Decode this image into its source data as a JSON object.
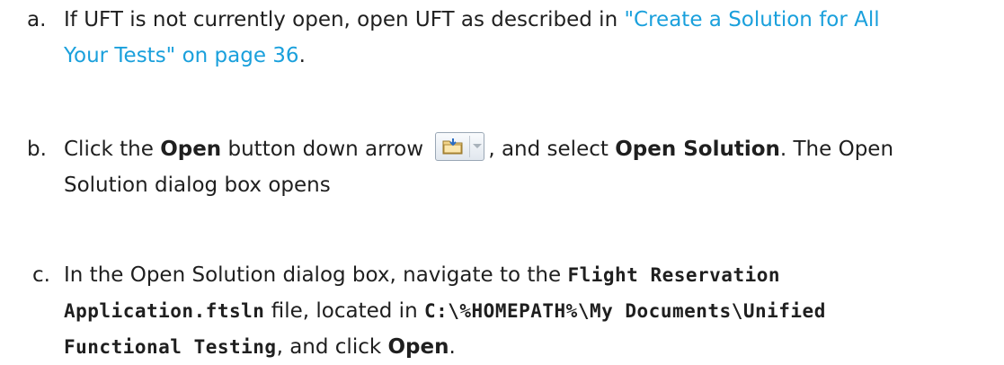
{
  "steps": [
    {
      "marker": "a.",
      "line1_text": "If UFT is not currently open, open UFT as described in ",
      "link_part1": "\"Create a Solution for All",
      "link_part2": "Your Tests\" on page 36",
      "line2_after": "."
    },
    {
      "marker": "b.",
      "t1": "Click the ",
      "b1": "Open",
      "t2": " button down arrow ",
      "t3": ", and select ",
      "b2": "Open Solution",
      "t4": ". The Open",
      "line2": "Solution dialog box opens"
    },
    {
      "marker": "c.",
      "t1": "In the Open Solution dialog box, navigate to the ",
      "b1": "Flight Reservation",
      "b2": "Application.ftsln",
      "t2": " file, located in ",
      "b3": "C:\\%HOMEPATH%\\My Documents\\Unified",
      "b4": "Functional Testing",
      "t3": ", and click ",
      "b5": "Open",
      "t4": "."
    }
  ],
  "icons": {
    "open_button": "open-folder-icon",
    "dropdown": "chevron-down-icon"
  },
  "colors": {
    "link": "#1aa0dc",
    "text": "#1f1f1f"
  }
}
